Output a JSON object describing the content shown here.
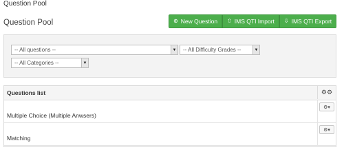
{
  "breadcrumb": "Question Pool",
  "page_title": "Question Pool",
  "toolbar": {
    "new_question_label": "New Question",
    "ims_import_label": "IMS QTI Import",
    "ims_export_label": "IMS QTI Export",
    "accent_color": "#4cae4c"
  },
  "filters": {
    "questions_selected": "-- All questions --",
    "difficulty_selected": "-- All Difficulty Grades --",
    "categories_selected": "-- All Categories --"
  },
  "questions_list": {
    "header": "Questions list",
    "rows": [
      {
        "label": "Multiple Choice (Multiple Anwsers)"
      },
      {
        "label": "Matching"
      }
    ]
  }
}
